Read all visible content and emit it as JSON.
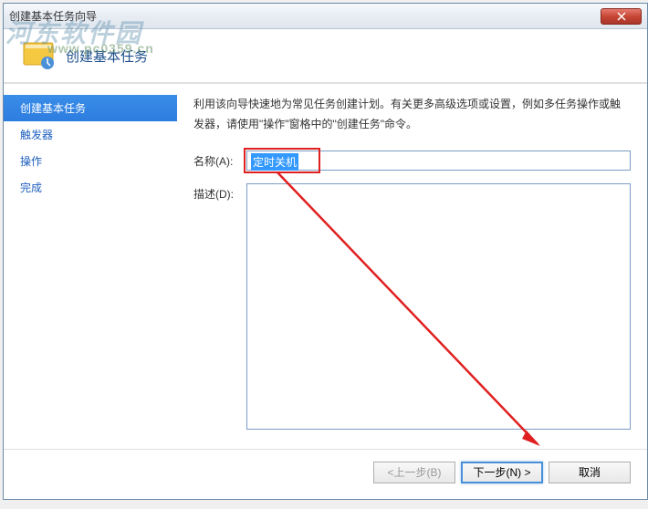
{
  "window": {
    "title": "创建基本任务向导"
  },
  "header": {
    "title": "创建基本任务"
  },
  "sidebar": {
    "items": [
      {
        "label": "创建基本任务",
        "active": true
      },
      {
        "label": "触发器",
        "active": false
      },
      {
        "label": "操作",
        "active": false
      },
      {
        "label": "完成",
        "active": false
      }
    ]
  },
  "main": {
    "intro": "利用该向导快速地为常见任务创建计划。有关更多高级选项或设置，例如多任务操作或触发器，请使用\"操作\"窗格中的\"创建任务\"命令。",
    "name_label": "名称(A):",
    "name_value": "定时关机",
    "desc_label": "描述(D):",
    "desc_value": ""
  },
  "footer": {
    "back_label": "<上一步(B)",
    "next_label": "下一步(N) >",
    "cancel_label": "取消"
  },
  "watermark": {
    "text": "河东软件园",
    "url": "www.pc0359.cn"
  }
}
